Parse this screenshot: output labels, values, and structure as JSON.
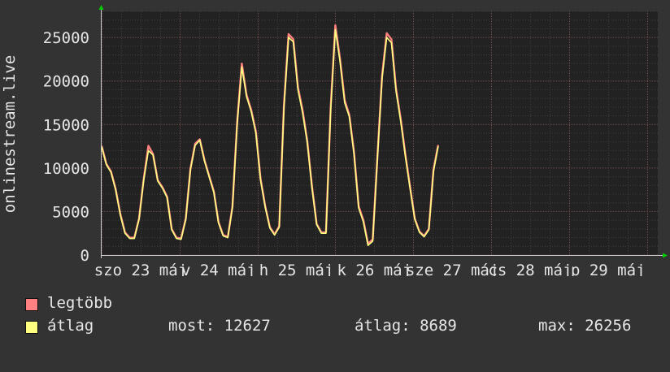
{
  "chart_data": {
    "type": "line",
    "ylabel": "onlinestream.live",
    "ylim": [
      0,
      28000
    ],
    "yticks": [
      0,
      5000,
      10000,
      15000,
      20000,
      25000
    ],
    "xticks": [
      "szo 23 máj",
      "v 24 máj",
      "h 25 máj",
      "k 26 máj",
      "sze 27 máj",
      "cs 28 máj",
      "p 29 máj"
    ],
    "grid": true,
    "x_days": [
      0,
      0.06,
      0.12,
      0.18,
      0.24,
      0.3,
      0.36,
      0.42,
      0.48,
      0.54,
      0.6,
      0.66,
      0.72,
      0.78,
      0.84,
      0.9,
      0.96,
      1.02,
      1.08,
      1.14,
      1.2,
      1.26,
      1.32,
      1.38,
      1.44,
      1.5,
      1.56,
      1.62,
      1.68,
      1.74,
      1.8,
      1.86,
      1.92,
      1.98,
      2.04,
      2.1,
      2.16,
      2.22,
      2.28,
      2.34,
      2.4,
      2.46,
      2.52,
      2.58,
      2.64,
      2.7,
      2.76,
      2.82,
      2.88,
      2.94,
      3.0,
      3.06,
      3.12,
      3.18,
      3.24,
      3.3,
      3.36,
      3.42,
      3.48,
      3.54,
      3.6,
      3.66,
      3.72,
      3.78,
      3.84,
      3.9,
      3.96,
      4.02,
      4.08,
      4.14,
      4.2,
      4.26,
      4.32,
      4.38,
      4.44,
      4.5,
      4.56,
      4.62,
      4.68,
      4.74,
      4.8,
      4.86,
      4.92,
      4.98,
      5.04,
      5.1,
      5.16,
      5.22,
      5.28,
      5.34,
      5.4,
      5.46,
      5.52,
      5.58,
      5.64,
      5.7,
      5.76,
      5.82,
      5.88,
      5.94,
      6.0,
      6.06,
      6.12,
      6.18,
      6.24,
      6.3,
      6.36,
      6.42,
      6.48,
      6.54,
      6.6,
      6.66,
      6.72,
      6.78,
      6.84,
      6.9,
      6.96,
      7.02,
      7.08,
      7.14,
      7.2
    ],
    "series": [
      {
        "name": "legtöbb",
        "color": "#ff8080",
        "values": [
          12550,
          10500,
          9600,
          7600,
          4700,
          2600,
          2000,
          2000,
          4200,
          8700,
          12550,
          11600,
          8600,
          7800,
          6700,
          3000,
          2000,
          1900,
          4200,
          9900,
          12800,
          13300,
          10900,
          9100,
          7300,
          3800,
          2300,
          2100,
          5600,
          15300,
          22000,
          18400,
          16700,
          14200,
          8800,
          5600,
          3200,
          2400,
          3300,
          17200,
          25400,
          24800,
          19300,
          16600,
          13100,
          7900,
          3600,
          2600,
          2600,
          17000,
          26400,
          22600,
          17800,
          16100,
          11800,
          5600,
          4000,
          1300,
          1800,
          11200,
          20600,
          25500,
          24800,
          19100,
          15600,
          11500,
          7800,
          4200,
          2700,
          2200,
          3000,
          9800,
          12650
        ]
      },
      {
        "name": "átlag",
        "color": "#ffff80",
        "values": [
          12450,
          10400,
          9500,
          7500,
          4600,
          2500,
          1900,
          1900,
          4100,
          8600,
          12000,
          11500,
          8500,
          7700,
          6600,
          2900,
          1900,
          1800,
          4100,
          9800,
          12600,
          13200,
          10800,
          9000,
          7200,
          3700,
          2200,
          2000,
          5500,
          15100,
          21600,
          18200,
          16500,
          14000,
          8600,
          5500,
          3100,
          2300,
          3200,
          16900,
          25000,
          24500,
          19000,
          16300,
          12900,
          7700,
          3500,
          2500,
          2500,
          16700,
          25900,
          22300,
          17500,
          15900,
          11600,
          5400,
          3800,
          1100,
          1600,
          11000,
          20300,
          25000,
          24400,
          18800,
          15300,
          11300,
          7600,
          4100,
          2600,
          2100,
          2900,
          9600,
          12500
        ]
      }
    ]
  },
  "legend": {
    "max_label": "legtöbb",
    "avg_label": "átlag",
    "max_color": "#ff8080",
    "avg_color": "#ffff80"
  },
  "stats": {
    "now": "most: 12627",
    "avg": "átlag: 8689",
    "max": "max: 26256"
  }
}
